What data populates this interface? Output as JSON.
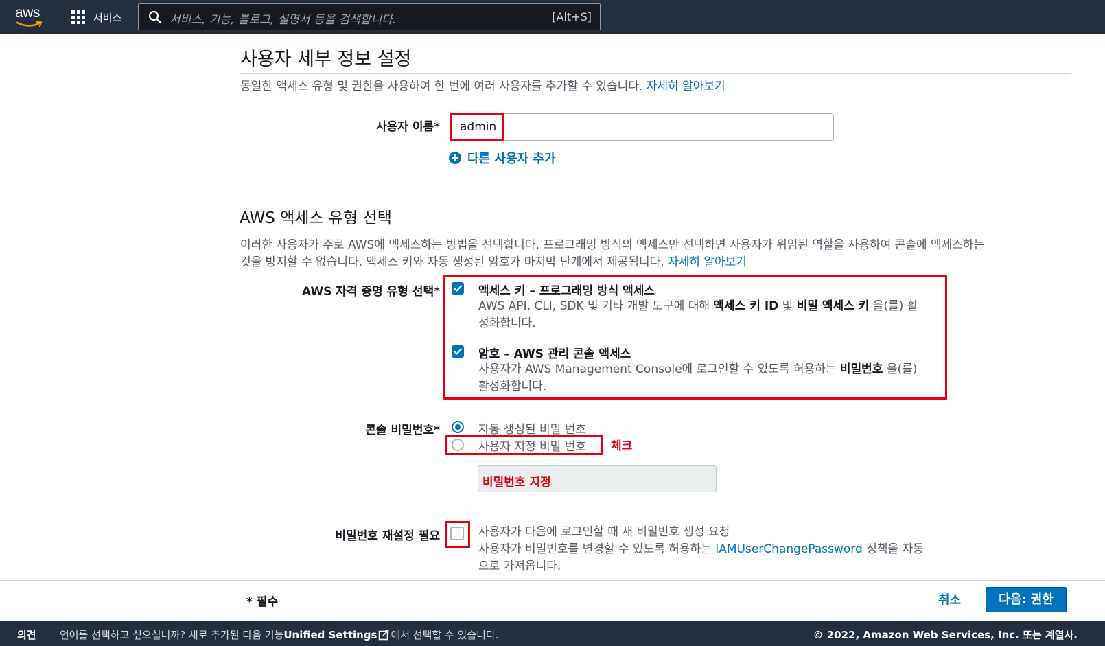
{
  "header": {
    "logo_text": "aws",
    "services_label": "서비스",
    "search_placeholder": "서비스, 기능, 블로그, 설명서 등을 검색합니다.",
    "search_shortcut": "[Alt+S]"
  },
  "user_details": {
    "title": "사용자 세부 정보 설정",
    "description": "동일한 액세스 유형 및 권한을 사용하여 한 번에 여러 사용자를 추가할 수 있습니다.",
    "learn_more": "자세히 알아보기",
    "username_label": "사용자 이름*",
    "username_value": "admin",
    "add_user_label": "다른 사용자 추가"
  },
  "access_type": {
    "title": "AWS 액세스 유형 선택",
    "description_line1": "이러한 사용자가 주로 AWS에 액세스하는 방법을 선택합니다. 프로그래밍 방식의 액세스만 선택하면 사용자가 위임된 역할을 사용하여 콘솔에 액세스하는",
    "description_line2": "것을 방지할 수 없습니다. 액세스 키와 자동 생성된 암호가 마지막 단계에서 제공됩니다.",
    "learn_more": "자세히 알아보기",
    "credential_label": "AWS 자격 증명 유형 선택*",
    "options": [
      {
        "title": "액세스 키 – 프로그래밍 방식 액세스",
        "desc_pre": "AWS API, CLI, SDK 및 기타 개발 도구에 대해 ",
        "desc_b1": "액세스 키 ID",
        "desc_mid": " 및 ",
        "desc_b2": "비밀 액세스 키",
        "desc_post": " 을(를) 활",
        "desc_line2": "성화합니다.",
        "checked": true
      },
      {
        "title": "암호 – AWS 관리 콘솔 액세스",
        "desc_pre": "사용자가 AWS Management Console에 로그인할 수 있도록 허용하는 ",
        "desc_b1": "비밀번호",
        "desc_post": " 을(를)",
        "desc_line2": "활성화합니다.",
        "checked": true
      }
    ]
  },
  "console_password": {
    "label": "콘솔 비밀번호*",
    "auto_label": "자동 생성된 비밀 번호",
    "custom_label": "사용자 지정 비밀 번호",
    "selected": "auto",
    "note": "체크",
    "custom_field_text": "비밀번호 지정"
  },
  "password_reset": {
    "label": "비밀번호 재설정 필요",
    "line1": "사용자가 다음에 로그인할 때 새 비밀번호 생성 요청",
    "line2_pre": "사용자가 비밀번호를 변경할 수 있도록 허용하는 ",
    "line2_link": "IAMUserChangePassword",
    "line2_post": " 정책을 자동",
    "line3": "으로 가져옵니다.",
    "checked": false
  },
  "footer": {
    "required_note": "* 필수",
    "cancel_label": "취소",
    "next_label": "다음: 권한"
  },
  "bottom_bar": {
    "feedback": "의견",
    "lang_pre": "언어를 선택하고 싶으십니까? 새로 추가된 다음 기능",
    "lang_bold": "Unified Settings",
    "lang_post": "에서 선택할 수 있습니다.",
    "copyright": "© 2022, Amazon Web Services, Inc. 또는 계열사."
  },
  "colors": {
    "nav_bg": "#232f3e",
    "link": "#0073bb",
    "primary_button": "#0073bb",
    "annotation_red": "#e3000f"
  }
}
